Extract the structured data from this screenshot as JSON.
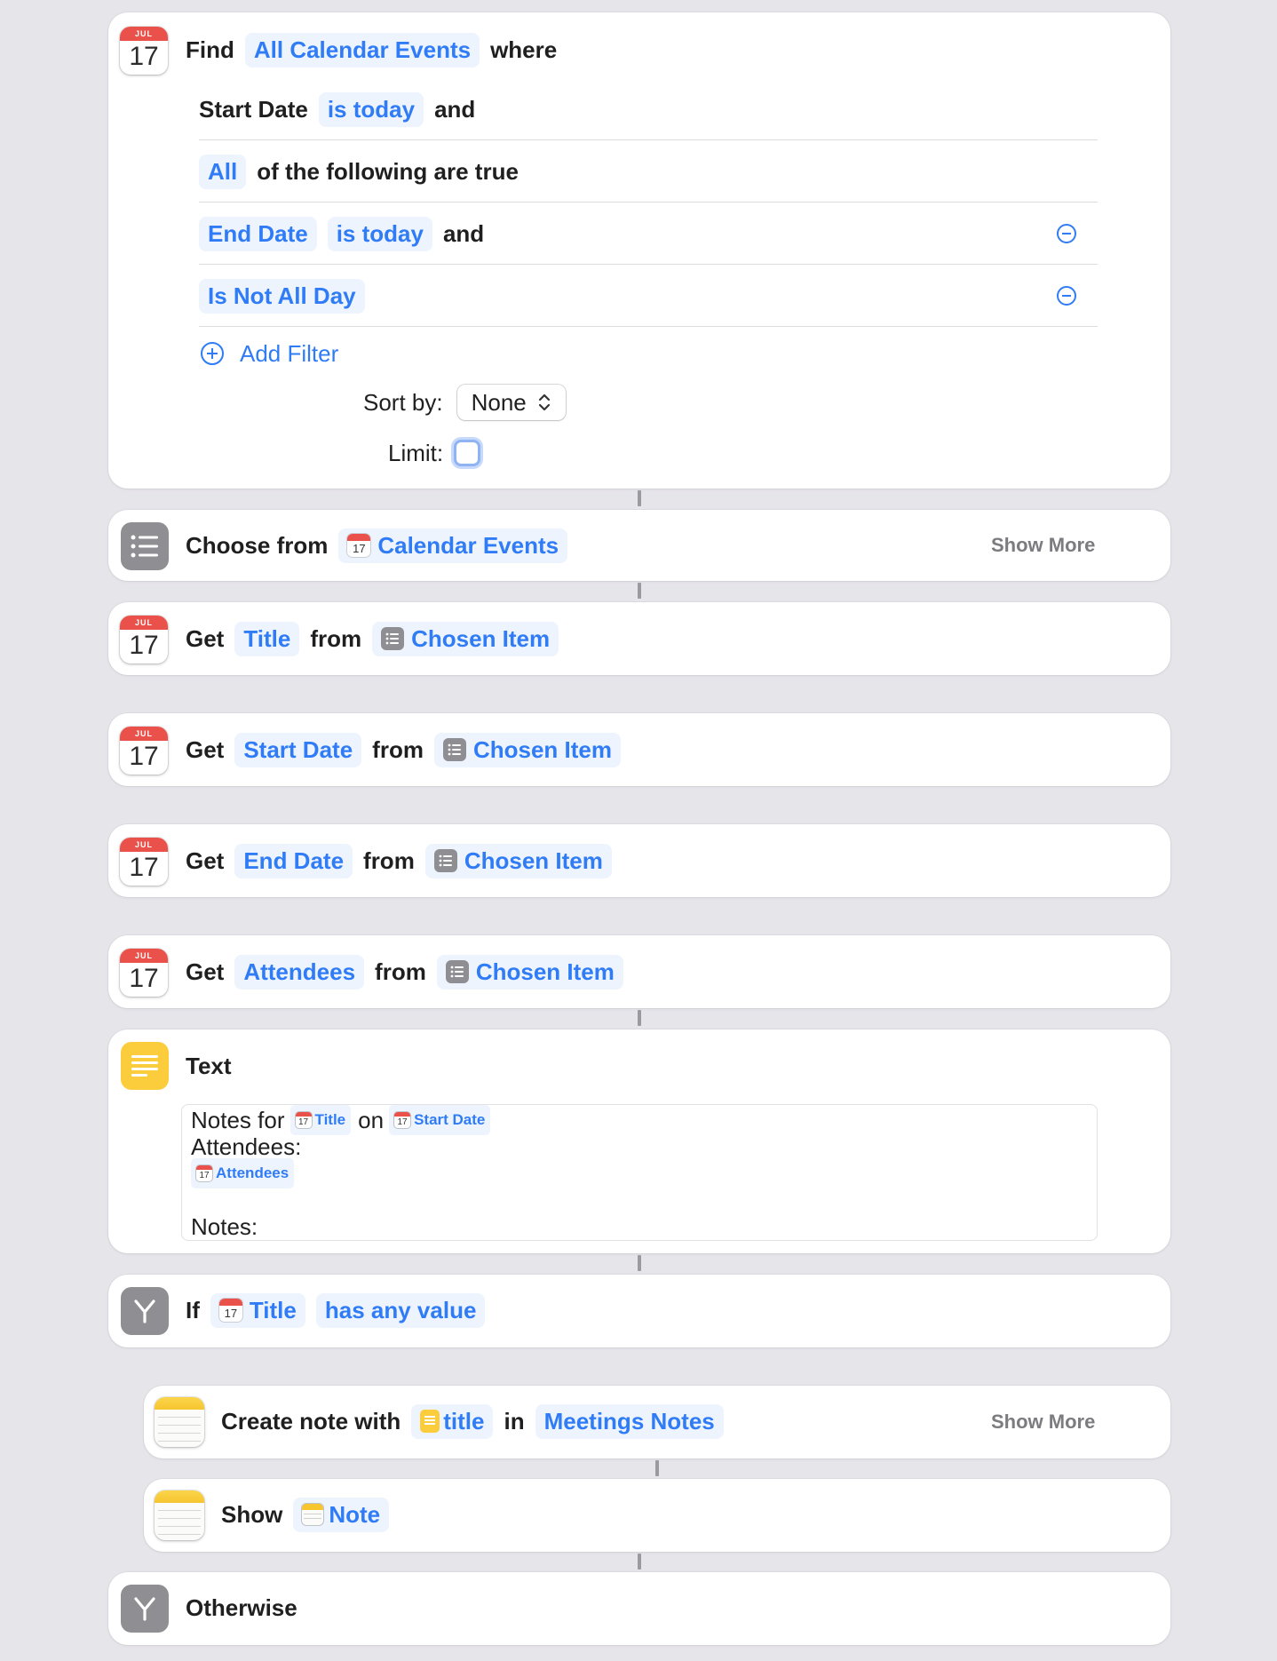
{
  "icons": {
    "calendar_month": "JUL",
    "calendar_day": "17"
  },
  "find_block": {
    "find": "Find",
    "source": "All Calendar Events",
    "where": "where",
    "filter1": {
      "field": "Start Date",
      "op": "is today",
      "conj": "and"
    },
    "group": {
      "mode": "All",
      "text": "of the following are true"
    },
    "filter2": {
      "field": "End Date",
      "op": "is today",
      "conj": "and"
    },
    "filter3": {
      "field": "Is Not All Day"
    },
    "add_filter": "Add Filter",
    "sort_label": "Sort by:",
    "sort_value": "None",
    "limit_label": "Limit:"
  },
  "choose_block": {
    "verb": "Choose from",
    "var": "Calendar Events",
    "show_more": "Show More"
  },
  "get_blocks": [
    {
      "verb": "Get",
      "prop": "Title",
      "from": "from",
      "var": "Chosen Item"
    },
    {
      "verb": "Get",
      "prop": "Start Date",
      "from": "from",
      "var": "Chosen Item"
    },
    {
      "verb": "Get",
      "prop": "End Date",
      "from": "from",
      "var": "Chosen Item"
    },
    {
      "verb": "Get",
      "prop": "Attendees",
      "from": "from",
      "var": "Chosen Item"
    }
  ],
  "text_block": {
    "title": "Text",
    "line1_prefix": "Notes for",
    "var_title": "Title",
    "on": "on",
    "var_start": "Start Date",
    "line2": "Attendees:",
    "var_attendees": "Attendees",
    "line4": "Notes:"
  },
  "if_block": {
    "verb": "If",
    "var": "Title",
    "cond": "has any value"
  },
  "create_note": {
    "verb": "Create note with",
    "var": "title",
    "in": "in",
    "folder": "Meetings Notes",
    "show_more": "Show More"
  },
  "show_note": {
    "verb": "Show",
    "var": "Note"
  },
  "otherwise": {
    "label": "Otherwise"
  },
  "colors": {
    "accent": "#2f7cf6",
    "background": "#e6e5ea",
    "calendar_red": "#e9514a",
    "notes_yellow": "#fbcd3d"
  }
}
